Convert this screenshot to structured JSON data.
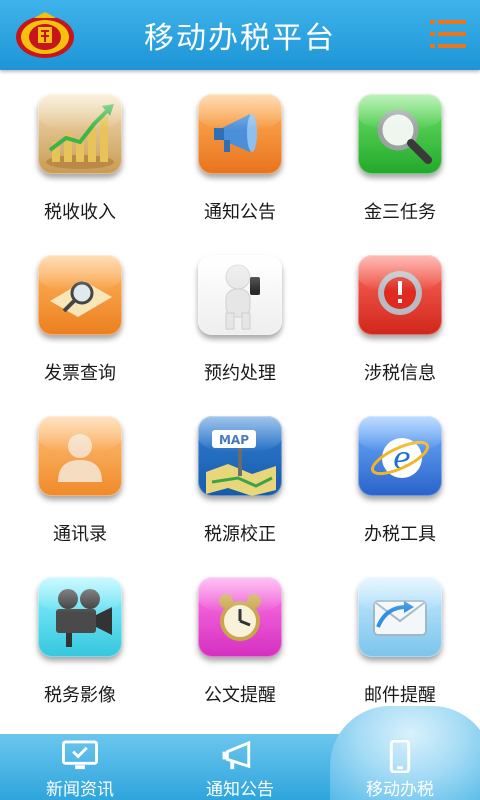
{
  "header": {
    "title": "移动办税平台"
  },
  "grid": [
    {
      "label": "税收收入",
      "icon": "growth-chart-icon"
    },
    {
      "label": "通知公告",
      "icon": "megaphone-icon"
    },
    {
      "label": "金三任务",
      "icon": "magnifier-icon"
    },
    {
      "label": "发票查询",
      "icon": "invoice-search-icon"
    },
    {
      "label": "预约处理",
      "icon": "person-phone-icon"
    },
    {
      "label": "涉税信息",
      "icon": "alert-icon"
    },
    {
      "label": "通讯录",
      "icon": "contact-icon"
    },
    {
      "label": "税源校正",
      "icon": "map-icon"
    },
    {
      "label": "办税工具",
      "icon": "internet-explorer-icon"
    },
    {
      "label": "税务影像",
      "icon": "video-camera-icon"
    },
    {
      "label": "公文提醒",
      "icon": "alarm-clock-icon"
    },
    {
      "label": "邮件提醒",
      "icon": "mail-icon"
    }
  ],
  "map_sign_text": "MAP",
  "tabs": [
    {
      "label": "新闻资讯",
      "icon": "monitor-icon"
    },
    {
      "label": "通知公告",
      "icon": "megaphone-icon"
    },
    {
      "label": "移动办税",
      "icon": "mobile-phone-icon"
    }
  ],
  "active_tab": "移动办税",
  "colors": {
    "header": "#2aa6e2",
    "bottom_bar": "#4ab6e6",
    "menu": "#e8761e"
  }
}
